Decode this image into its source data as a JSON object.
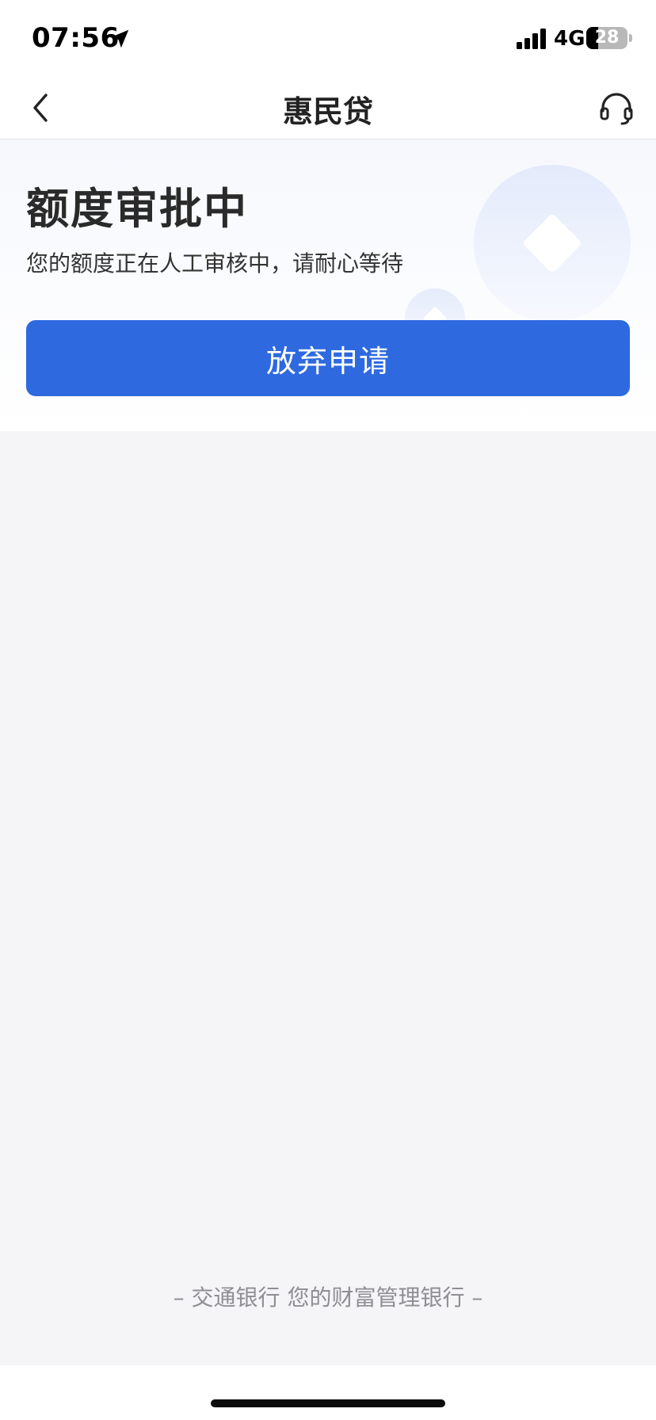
{
  "status_bar": {
    "time": "07:56",
    "network": "4G",
    "battery": "28",
    "battery_level_percent": 28,
    "icons": [
      "location-arrow-icon",
      "cellular-signal-icon",
      "battery-icon"
    ]
  },
  "nav": {
    "title": "惠民贷",
    "back_icon": "chevron-left-icon",
    "support_icon": "headset-icon"
  },
  "status": {
    "title": "额度审批中",
    "description": "您的额度正在人工审核中，请耐心等待",
    "button_label": "放弃申请"
  },
  "footer": {
    "slogan": "– 交通银行 您的财富管理银行 –"
  },
  "colors": {
    "primary": "#2e69e0",
    "page_background": "#f5f5f7",
    "header_background": "#f6f8fd",
    "slogan_text": "#8e8e93"
  }
}
